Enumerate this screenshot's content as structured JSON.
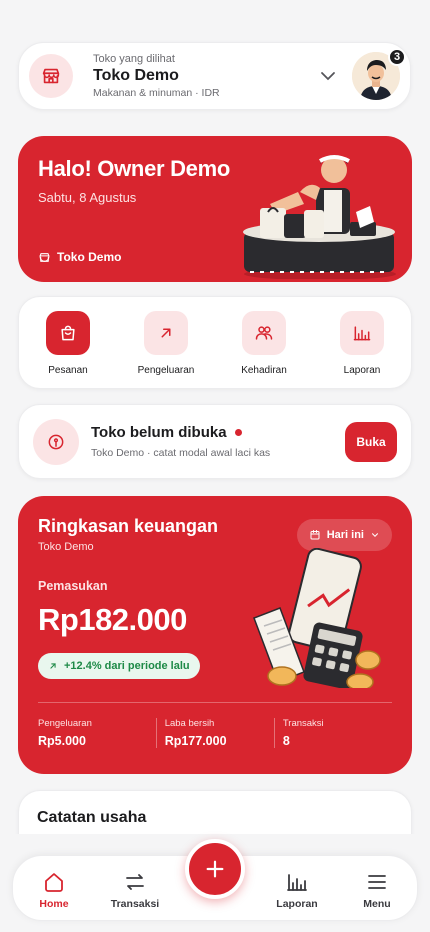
{
  "store_selector": {
    "label": "Toko yang dilihat",
    "name": "Toko Demo",
    "subtitle": "Makanan & minuman · IDR",
    "notification_count": "3"
  },
  "hero": {
    "greeting": "Halo! Owner Demo",
    "date": "Sabtu, 8 Agustus",
    "store": "Toko Demo"
  },
  "quick_actions": [
    {
      "label": "Pesanan",
      "icon": "shopping-bag-icon"
    },
    {
      "label": "Pengeluaran",
      "icon": "arrow-up-right-icon"
    },
    {
      "label": "Kehadiran",
      "icon": "users-icon"
    },
    {
      "label": "Laporan",
      "icon": "bar-chart-icon"
    }
  ],
  "store_status": {
    "title": "Toko belum dibuka",
    "subtitle": "Toko Demo · catat modal awal laci kas",
    "button": "Buka"
  },
  "finance": {
    "title": "Ringkasan keuangan",
    "store": "Toko Demo",
    "period": "Hari ini",
    "income_label": "Pemasukan",
    "income_value": "Rp182.000",
    "growth": "+12.4% dari periode lalu",
    "stats": [
      {
        "label": "Pengeluaran",
        "value": "Rp5.000"
      },
      {
        "label": "Laba bersih",
        "value": "Rp177.000"
      },
      {
        "label": "Transaksi",
        "value": "8"
      }
    ]
  },
  "notes": {
    "title": "Catatan usaha"
  },
  "bottom_nav": [
    {
      "label": "Home",
      "icon": "home-icon"
    },
    {
      "label": "Transaksi",
      "icon": "transfer-icon"
    },
    {
      "label": "Laporan",
      "icon": "bar-chart-icon"
    },
    {
      "label": "Menu",
      "icon": "menu-icon"
    }
  ],
  "colors": {
    "primary": "#d8252f",
    "primary_soft": "#fbe4e5",
    "success": "#1e8a47"
  }
}
